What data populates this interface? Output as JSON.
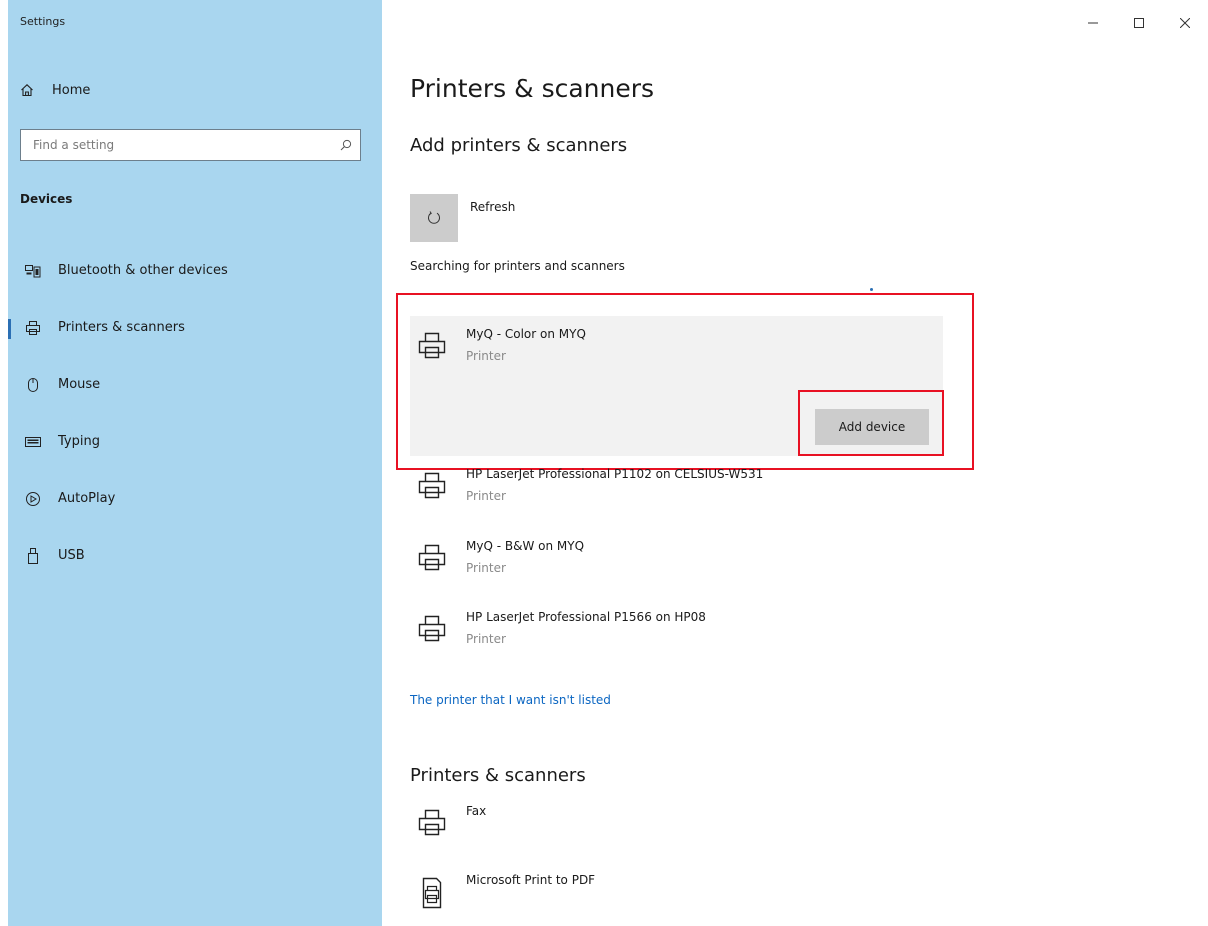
{
  "window": {
    "title": "Settings",
    "controls": [
      "minimize-icon",
      "maximize-icon",
      "close-icon"
    ]
  },
  "sidebar": {
    "home_label": "Home",
    "search": {
      "placeholder": "Find a setting",
      "value": ""
    },
    "section": "Devices",
    "items": [
      {
        "label": "Bluetooth & other devices",
        "icon": "bluetooth-devices-icon"
      },
      {
        "label": "Printers & scanners",
        "icon": "printer-icon",
        "active": true
      },
      {
        "label": "Mouse",
        "icon": "mouse-icon"
      },
      {
        "label": "Typing",
        "icon": "keyboard-icon"
      },
      {
        "label": "AutoPlay",
        "icon": "autoplay-icon"
      },
      {
        "label": "USB",
        "icon": "usb-icon"
      }
    ]
  },
  "main": {
    "title": "Printers & scanners",
    "add_section_title": "Add printers & scanners",
    "refresh_label": "Refresh",
    "searching_text": "Searching for printers and scanners",
    "found_devices": [
      {
        "name": "MyQ - Color on MYQ",
        "kind": "Printer",
        "selected": true
      },
      {
        "name": "HP LaserJet Professional P1102 on CELSIUS-W531",
        "kind": "Printer"
      },
      {
        "name": "MyQ - B&W on MYQ",
        "kind": "Printer"
      },
      {
        "name": "HP LaserJet Professional P1566 on HP08",
        "kind": "Printer"
      }
    ],
    "add_device_label": "Add device",
    "not_listed_link": "The printer that I want isn't listed",
    "installed_section_title": "Printers & scanners",
    "installed": [
      {
        "name": "Fax",
        "icon": "printer-icon"
      },
      {
        "name": "Microsoft Print to PDF",
        "icon": "pdf-printer-icon"
      }
    ]
  },
  "colors": {
    "sidebar_bg": "#a9d6ef",
    "accent": "#2b6fb4",
    "link": "#0b66c2",
    "highlight": "#e81123",
    "selected_bg": "#f2f2f2",
    "button_bg": "#cccccc"
  }
}
